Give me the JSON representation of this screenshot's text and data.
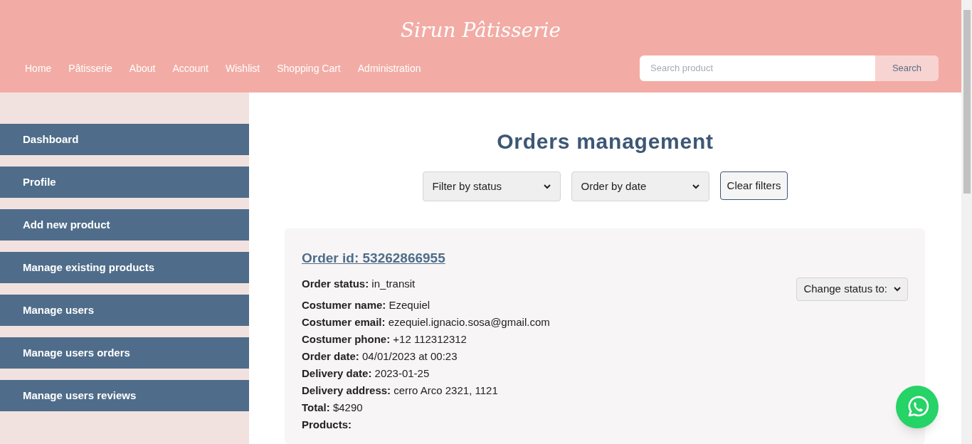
{
  "brand": "Sirun Pâtisserie",
  "nav": [
    "Home",
    "Pâtisserie",
    "About",
    "Account",
    "Wishlist",
    "Shopping Cart",
    "Administration"
  ],
  "search": {
    "placeholder": "Search product",
    "button": "Search"
  },
  "sidebar": {
    "items": [
      "Dashboard",
      "Profile",
      "Add new product",
      "Manage existing products",
      "Manage users",
      "Manage users orders",
      "Manage users reviews"
    ]
  },
  "title": "Orders management",
  "filters": {
    "status_select": "Filter by status",
    "date_select": "Order by date",
    "clear_button": "Clear filters"
  },
  "order": {
    "id_link": "Order id: 53262866955",
    "status": "**Order status:** in_transit",
    "change_status": "Change status to:",
    "details": [
      "**Costumer name:** Ezequiel",
      "**Costumer email:** ezequiel.ignacio.sosa@gmail.com",
      "**Costumer phone:** +12 112312312",
      "**Order date:** 04/01/2023 at 00:23",
      "**Delivery date:** 2023-01-25",
      "**Delivery address:** cerro Arco 2321, 1121",
      "**Total:** $4290",
      "**Products:**"
    ]
  }
}
